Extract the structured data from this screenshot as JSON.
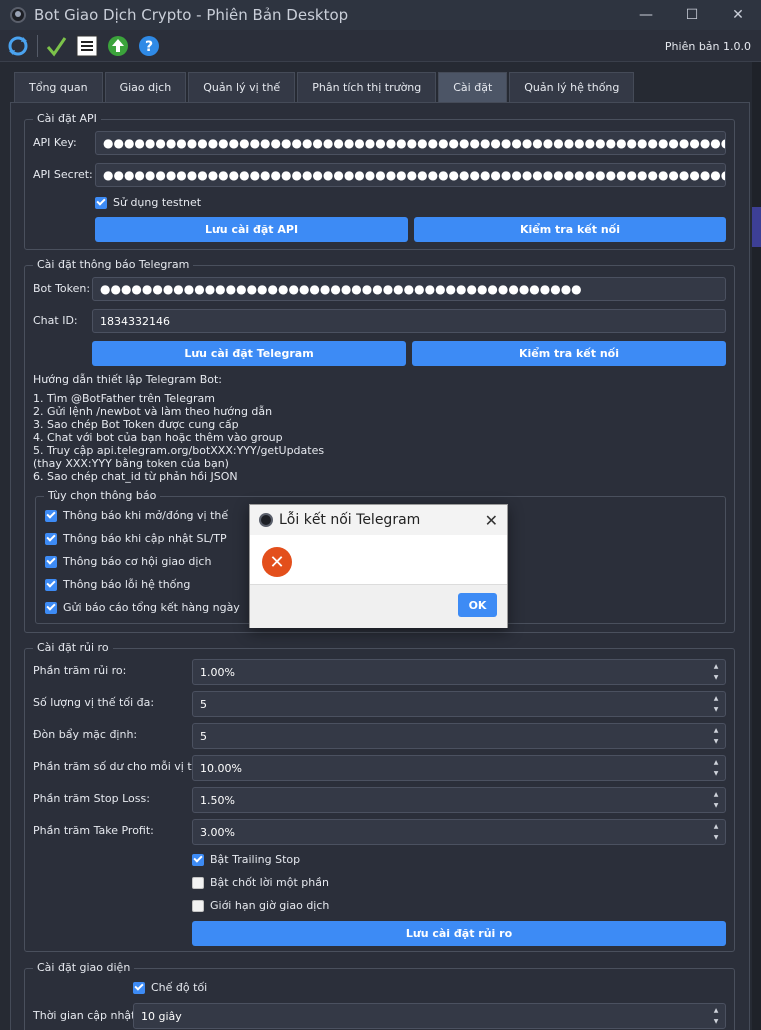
{
  "window": {
    "title": "Bot Giao Dịch Crypto - Phiên Bản Desktop"
  },
  "toolbar": {
    "version": "Phiên bản 1.0.0"
  },
  "tabs": [
    {
      "label": "Tổng quan"
    },
    {
      "label": "Giao dịch"
    },
    {
      "label": "Quản lý vị thế"
    },
    {
      "label": "Phân tích thị trường"
    },
    {
      "label": "Cài đặt"
    },
    {
      "label": "Quản lý hệ thống"
    }
  ],
  "api": {
    "title": "Cài đặt API",
    "key_label": "API Key:",
    "key_value": "●●●●●●●●●●●●●●●●●●●●●●●●●●●●●●●●●●●●●●●●●●●●●●●●●●●●●●●●●●●●●●●●",
    "secret_label": "API Secret:",
    "secret_value": "●●●●●●●●●●●●●●●●●●●●●●●●●●●●●●●●●●●●●●●●●●●●●●●●●●●●●●●●●●●●●●●●",
    "testnet_label": "Sử dụng testnet",
    "save_label": "Lưu cài đặt API",
    "test_label": "Kiểm tra kết nối"
  },
  "telegram": {
    "title": "Cài đặt thông báo Telegram",
    "token_label": "Bot Token:",
    "token_value": "●●●●●●●●●●●●●●●●●●●●●●●●●●●●●●●●●●●●●●●●●●●●●●",
    "chat_label": "Chat ID:",
    "chat_value": "1834332146",
    "save_label": "Lưu cài đặt Telegram",
    "test_label": "Kiểm tra kết nối",
    "guide_title": "Hướng dẫn thiết lập Telegram Bot:",
    "guide_text": "1. Tìm @BotFather trên Telegram\n2. Gửi lệnh /newbot và làm theo hướng dẫn\n3. Sao chép Bot Token được cung cấp\n4. Chat với bot của bạn hoặc thêm vào group\n5. Truy cập api.telegram.org/botXXX:YYY/getUpdates\n(thay XXX:YYY bằng token của bạn)\n6. Sao chép chat_id từ phản hồi JSON",
    "options_title": "Tùy chọn thông báo",
    "options": [
      "Thông báo khi mở/đóng vị thế",
      "Thông báo khi cập nhật SL/TP",
      "Thông báo cơ hội giao dịch",
      "Thông báo lỗi hệ thống",
      "Gửi báo cáo tổng kết hàng ngày"
    ]
  },
  "risk": {
    "title": "Cài đặt rủi ro",
    "fields": [
      {
        "label": "Phần trăm rủi ro:",
        "value": "1.00%"
      },
      {
        "label": "Số lượng vị thế tối đa:",
        "value": "5"
      },
      {
        "label": "Đòn bẩy mặc định:",
        "value": "5"
      },
      {
        "label": "Phần trăm số dư cho mỗi vị thế:",
        "value": "10.00%"
      },
      {
        "label": "Phần trăm Stop Loss:",
        "value": "1.50%"
      },
      {
        "label": "Phần trăm Take Profit:",
        "value": "3.00%"
      }
    ],
    "checks": [
      {
        "label": "Bật Trailing Stop",
        "checked": true
      },
      {
        "label": "Bật chốt lời một phần",
        "checked": false
      },
      {
        "label": "Giới hạn giờ giao dịch",
        "checked": false
      }
    ],
    "save_label": "Lưu cài đặt rủi ro"
  },
  "ui": {
    "title": "Cài đặt giao diện",
    "dark_label": "Chế độ tối",
    "refresh_label": "Thời gian cập nhật:",
    "refresh_value": "10 giây"
  },
  "dialog": {
    "title": "Lỗi kết nối Telegram",
    "ok_label": "OK"
  },
  "colors": {
    "accent": "#3d8bf5",
    "error": "#e34f1c",
    "background": "#2b2f3a"
  }
}
